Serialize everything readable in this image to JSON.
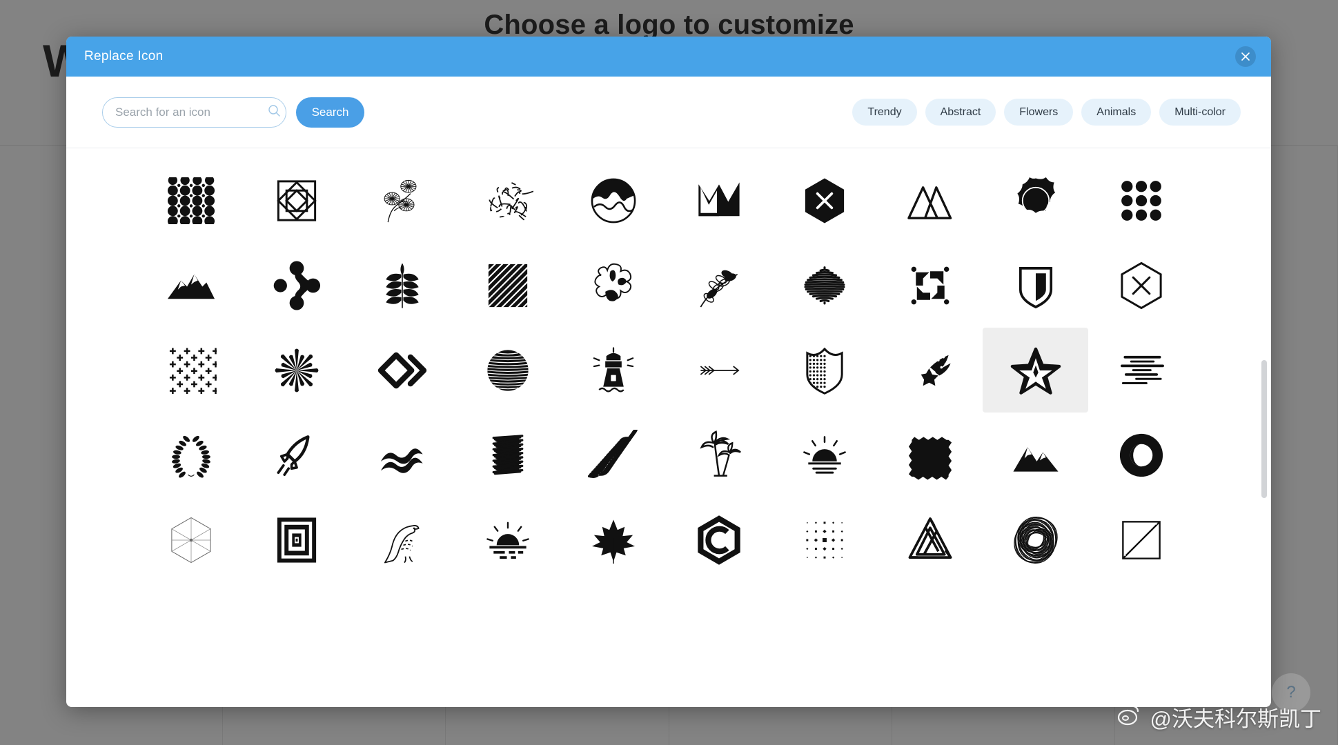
{
  "background": {
    "hero_title": "Choose a logo to customize",
    "partial_heading": "W"
  },
  "modal": {
    "title": "Replace Icon",
    "close_icon": "close-icon"
  },
  "toolbar": {
    "search_placeholder": "Search for an icon",
    "search_value": "",
    "search_icon": "search-icon",
    "search_button": "Search",
    "chips": [
      {
        "label": "Trendy"
      },
      {
        "label": "Abstract"
      },
      {
        "label": "Flowers"
      },
      {
        "label": "Animals"
      },
      {
        "label": "Multi-color"
      }
    ]
  },
  "colors": {
    "header_blue": "#47a3e8",
    "button_blue": "#4a9fe6",
    "chip_bg": "#e6f2fb",
    "selected_cell": "#eeeeee",
    "icon_black": "#111111"
  },
  "icon_grid": {
    "columns": 10,
    "selected_index": 28,
    "icons": [
      {
        "name": "polka-dot-pattern-icon"
      },
      {
        "name": "nested-square-diamond-icon"
      },
      {
        "name": "botanical-leaves-sketch-icon"
      },
      {
        "name": "scribble-ball-icon"
      },
      {
        "name": "circle-mountain-waves-icon"
      },
      {
        "name": "crown-zigzag-icon"
      },
      {
        "name": "hexagon-x-filled-icon"
      },
      {
        "name": "twin-triangles-icon"
      },
      {
        "name": "wax-seal-blob-icon"
      },
      {
        "name": "nine-dot-grid-icon"
      },
      {
        "name": "mountain-silhouette-icon"
      },
      {
        "name": "molecule-nodes-icon"
      },
      {
        "name": "compound-leaf-icon"
      },
      {
        "name": "diagonal-stripes-icon"
      },
      {
        "name": "organic-blob-icon"
      },
      {
        "name": "botanical-sprig-icon"
      },
      {
        "name": "scribble-circle-icon"
      },
      {
        "name": "pinwheel-arrows-icon"
      },
      {
        "name": "shield-split-icon"
      },
      {
        "name": "hexagon-x-outline-icon"
      },
      {
        "name": "plus-sign-grid-icon"
      },
      {
        "name": "starburst-petals-icon"
      },
      {
        "name": "diamond-chevron-icon"
      },
      {
        "name": "striped-sphere-icon"
      },
      {
        "name": "lighthouse-icon"
      },
      {
        "name": "feathered-arrow-icon"
      },
      {
        "name": "dotted-shield-icon"
      },
      {
        "name": "shooting-star-icon"
      },
      {
        "name": "outlined-star-icon"
      },
      {
        "name": "speed-lines-icon"
      },
      {
        "name": "laurel-wreath-icon"
      },
      {
        "name": "rocket-icon"
      },
      {
        "name": "waves-icon"
      },
      {
        "name": "scribble-block-icon"
      },
      {
        "name": "palm-frond-icon"
      },
      {
        "name": "palm-trees-icon"
      },
      {
        "name": "sunset-rays-icon"
      },
      {
        "name": "zigzag-edge-square-icon"
      },
      {
        "name": "mountain-peaks-icon"
      },
      {
        "name": "circle-crescent-icon"
      },
      {
        "name": "hexagon-wireframe-icon"
      },
      {
        "name": "concentric-squares-icon"
      },
      {
        "name": "eagle-icon"
      },
      {
        "name": "sunrise-lines-icon"
      },
      {
        "name": "maple-leaf-icon"
      },
      {
        "name": "hexagon-c-monogram-icon"
      },
      {
        "name": "dot-matrix-icon"
      },
      {
        "name": "penrose-triangle-icon"
      },
      {
        "name": "scribble-round-icon"
      },
      {
        "name": "split-square-icon"
      }
    ]
  },
  "watermark": {
    "handle": "@沃夫科尔斯凯丁"
  },
  "help": {
    "label": "?"
  }
}
